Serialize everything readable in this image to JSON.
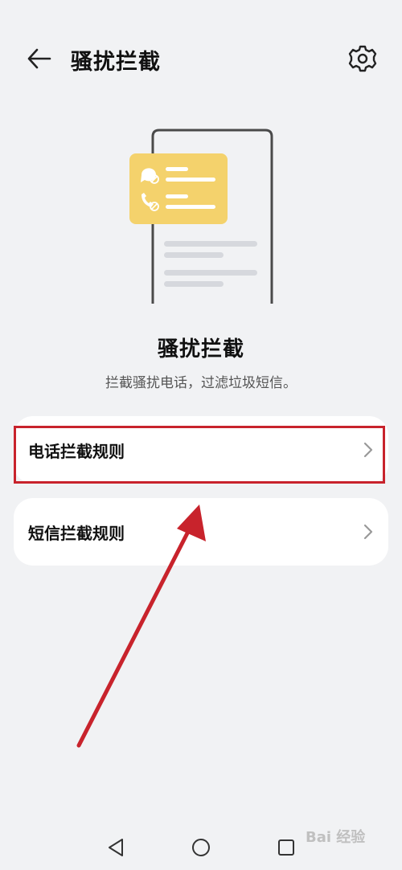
{
  "header": {
    "title": "骚扰拦截"
  },
  "hero": {
    "title": "骚扰拦截",
    "subtitle": "拦截骚扰电话，过滤垃圾短信。"
  },
  "menu": [
    {
      "label": "电话拦截规则"
    },
    {
      "label": "短信拦截规则"
    }
  ],
  "icons": {
    "back": "arrow-left",
    "settings": "gear",
    "chevron": "chevron-right",
    "nav_back": "triangle-left",
    "nav_home": "circle",
    "nav_recent": "square"
  },
  "colors": {
    "background": "#f1f2f4",
    "card": "#ffffff",
    "illustration_card": "#f4d26c",
    "highlight": "#c8232c"
  },
  "watermark": {
    "text": "Bai 经验"
  }
}
